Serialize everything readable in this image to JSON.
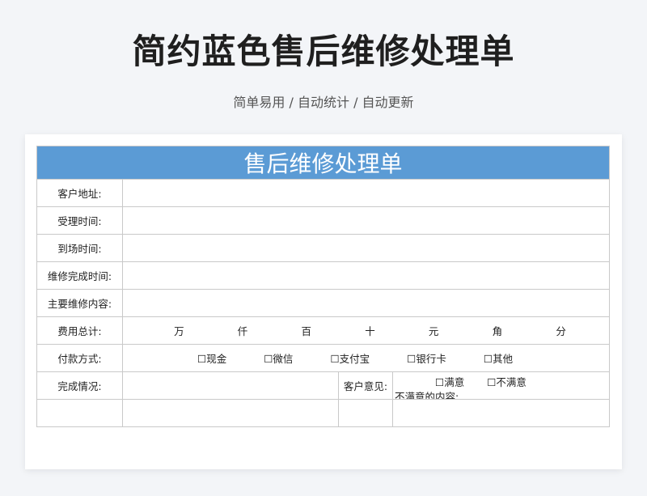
{
  "page": {
    "title": "简约蓝色售后维修处理单",
    "subtitle": "简单易用 / 自动统计 / 自动更新"
  },
  "form": {
    "header": "售后维修处理单",
    "rows": {
      "address": "客户地址:",
      "accept_time": "受理时间:",
      "arrival_time": "到场时间:",
      "finish_time": "维修完成时间:",
      "content": "主要维修内容:",
      "total": "费用总计:",
      "payment": "付款方式:",
      "completion": "完成情况:"
    },
    "units": [
      "万",
      "仟",
      "百",
      "十",
      "元",
      "角",
      "分"
    ],
    "payment_options": [
      "☐现金",
      "☐微信",
      "☐支付宝",
      "☐银行卡",
      "☐其他"
    ],
    "opinion": {
      "label": "客户意见:",
      "satisfied": "☐满意",
      "unsatisfied": "☐不满意",
      "dissatisfied_content": "不满意的内容:"
    }
  },
  "colors": {
    "header_bg": "#5b9bd5",
    "page_bg": "#f3f5f8"
  }
}
